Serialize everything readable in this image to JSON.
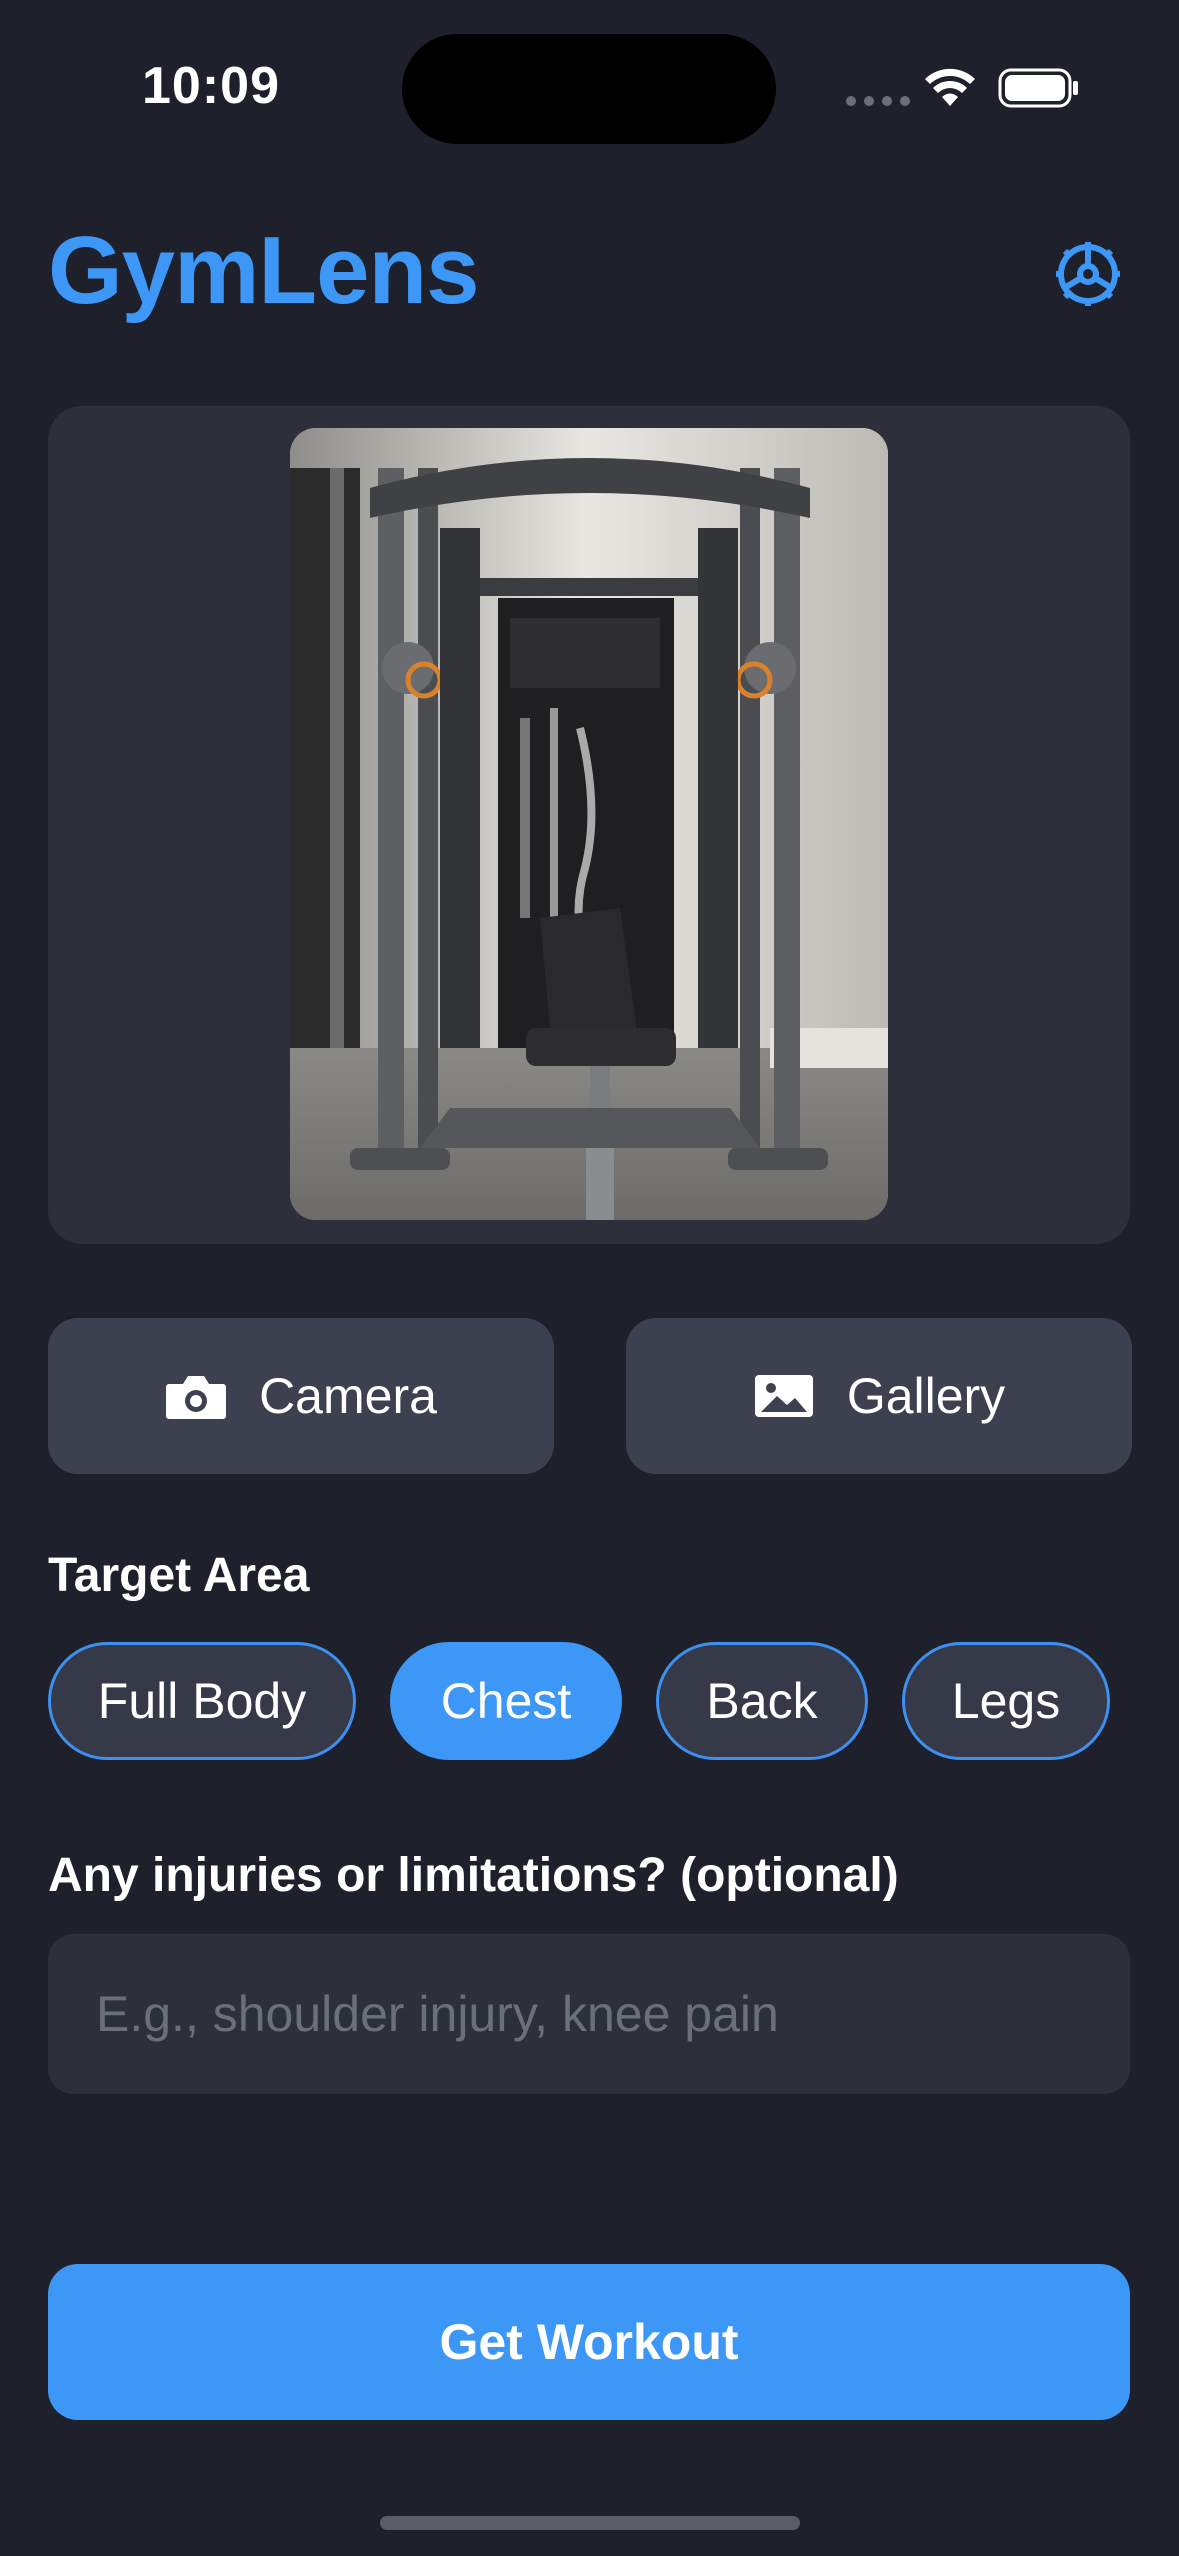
{
  "status_bar": {
    "time": "10:09"
  },
  "header": {
    "app_title": "GymLens",
    "settings_icon": "gear-icon"
  },
  "image_card": {
    "photo_icon": "gym-equipment-photo"
  },
  "source_buttons": {
    "camera_label": "Camera",
    "camera_icon": "camera-icon",
    "gallery_label": "Gallery",
    "gallery_icon": "photo-icon"
  },
  "target_area": {
    "label": "Target Area",
    "options": [
      "Full Body",
      "Chest",
      "Back",
      "Legs"
    ],
    "selected": "Chest"
  },
  "injuries": {
    "label": "Any injuries or limitations? (optional)",
    "placeholder": "E.g., shoulder injury, knee pain",
    "value": ""
  },
  "actions": {
    "primary_label": "Get Workout"
  },
  "colors": {
    "background": "#1e202b",
    "card": "#2d303b",
    "accent": "#3d97f7",
    "button": "#3d414f"
  }
}
